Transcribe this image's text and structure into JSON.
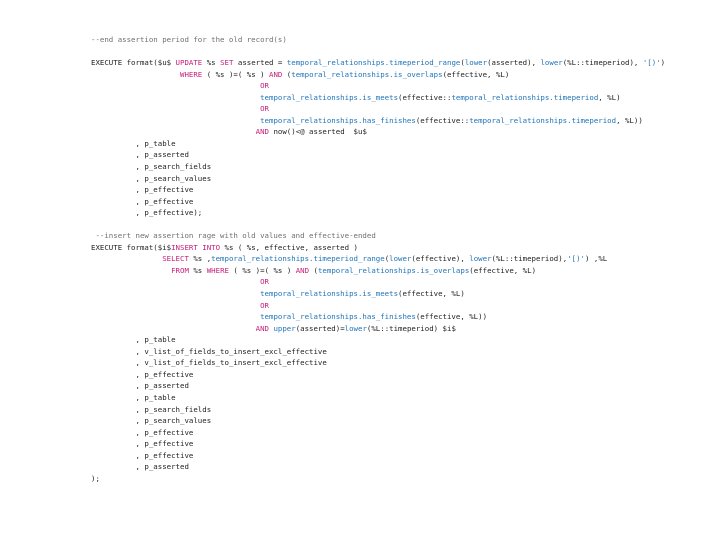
{
  "colors": {
    "plain": "#222222",
    "comment": "#6f6f6f",
    "keyword": "#c81e7a",
    "function": "#1e73b8",
    "string": "#1e73b8"
  },
  "code_lines": [
    {
      "indent": "",
      "tokens": [
        {
          "t": "--end assertion period for the old record(s)",
          "k": "comment"
        }
      ]
    },
    {
      "indent": "",
      "tokens": []
    },
    {
      "indent": "",
      "tokens": [
        {
          "t": "EXECUTE format($u$ ",
          "k": "plain"
        },
        {
          "t": "UPDATE",
          "k": "keyword"
        },
        {
          "t": " %s ",
          "k": "plain"
        },
        {
          "t": "SET",
          "k": "keyword"
        },
        {
          "t": " asserted = ",
          "k": "plain"
        },
        {
          "t": "temporal_relationships.timeperiod_range",
          "k": "function"
        },
        {
          "t": "(",
          "k": "plain"
        },
        {
          "t": "lower",
          "k": "function"
        },
        {
          "t": "(asserted), ",
          "k": "plain"
        },
        {
          "t": "lower",
          "k": "function"
        },
        {
          "t": "(%L::timeperiod), ",
          "k": "plain"
        },
        {
          "t": "'[)'",
          "k": "string"
        },
        {
          "t": ")",
          "k": "plain"
        }
      ]
    },
    {
      "indent": "                    ",
      "tokens": [
        {
          "t": "WHERE",
          "k": "keyword"
        },
        {
          "t": " ( %s )=( %s ) ",
          "k": "plain"
        },
        {
          "t": "AND",
          "k": "keyword"
        },
        {
          "t": " (",
          "k": "plain"
        },
        {
          "t": "temporal_relationships.is_overlaps",
          "k": "function"
        },
        {
          "t": "(effective, %L)",
          "k": "plain"
        }
      ]
    },
    {
      "indent": "                                      ",
      "tokens": [
        {
          "t": "OR",
          "k": "keyword"
        }
      ]
    },
    {
      "indent": "                                      ",
      "tokens": [
        {
          "t": "temporal_relationships.is_meets",
          "k": "function"
        },
        {
          "t": "(effective::",
          "k": "plain"
        },
        {
          "t": "temporal_relationships.timeperiod",
          "k": "function"
        },
        {
          "t": ", %L)",
          "k": "plain"
        }
      ]
    },
    {
      "indent": "                                      ",
      "tokens": [
        {
          "t": "OR",
          "k": "keyword"
        }
      ]
    },
    {
      "indent": "                                      ",
      "tokens": [
        {
          "t": "temporal_relationships.has_finishes",
          "k": "function"
        },
        {
          "t": "(effective::",
          "k": "plain"
        },
        {
          "t": "temporal_relationships.timeperiod",
          "k": "function"
        },
        {
          "t": ", %L))",
          "k": "plain"
        }
      ]
    },
    {
      "indent": "                                     ",
      "tokens": [
        {
          "t": "AND",
          "k": "keyword"
        },
        {
          "t": " now()<@ asserted  $u$",
          "k": "plain"
        }
      ]
    },
    {
      "indent": "          ",
      "tokens": [
        {
          "t": ", p_table",
          "k": "plain"
        }
      ]
    },
    {
      "indent": "          ",
      "tokens": [
        {
          "t": ", p_asserted",
          "k": "plain"
        }
      ]
    },
    {
      "indent": "          ",
      "tokens": [
        {
          "t": ", p_search_fields",
          "k": "plain"
        }
      ]
    },
    {
      "indent": "          ",
      "tokens": [
        {
          "t": ", p_search_values",
          "k": "plain"
        }
      ]
    },
    {
      "indent": "          ",
      "tokens": [
        {
          "t": ", p_effective",
          "k": "plain"
        }
      ]
    },
    {
      "indent": "          ",
      "tokens": [
        {
          "t": ", p_effective",
          "k": "plain"
        }
      ]
    },
    {
      "indent": "          ",
      "tokens": [
        {
          "t": ", p_effective);",
          "k": "plain"
        }
      ]
    },
    {
      "indent": "",
      "tokens": []
    },
    {
      "indent": " ",
      "tokens": [
        {
          "t": "--insert new assertion rage with old values and effective-ended",
          "k": "comment"
        }
      ]
    },
    {
      "indent": "",
      "tokens": [
        {
          "t": "EXECUTE format($i$",
          "k": "plain"
        },
        {
          "t": "INSERT INTO",
          "k": "keyword"
        },
        {
          "t": " %s ( %s, effective, asserted )",
          "k": "plain"
        }
      ]
    },
    {
      "indent": "                ",
      "tokens": [
        {
          "t": "SELECT",
          "k": "keyword"
        },
        {
          "t": " %s ,",
          "k": "plain"
        },
        {
          "t": "temporal_relationships.timeperiod_range",
          "k": "function"
        },
        {
          "t": "(",
          "k": "plain"
        },
        {
          "t": "lower",
          "k": "function"
        },
        {
          "t": "(effective), ",
          "k": "plain"
        },
        {
          "t": "lower",
          "k": "function"
        },
        {
          "t": "(%L::timeperiod),",
          "k": "plain"
        },
        {
          "t": "'[)'",
          "k": "string"
        },
        {
          "t": ") ,%L",
          "k": "plain"
        }
      ]
    },
    {
      "indent": "                  ",
      "tokens": [
        {
          "t": "FROM",
          "k": "keyword"
        },
        {
          "t": " %s ",
          "k": "plain"
        },
        {
          "t": "WHERE",
          "k": "keyword"
        },
        {
          "t": " ( %s )=( %s ) ",
          "k": "plain"
        },
        {
          "t": "AND",
          "k": "keyword"
        },
        {
          "t": " (",
          "k": "plain"
        },
        {
          "t": "temporal_relationships.is_overlaps",
          "k": "function"
        },
        {
          "t": "(effective, %L)",
          "k": "plain"
        }
      ]
    },
    {
      "indent": "                                      ",
      "tokens": [
        {
          "t": "OR",
          "k": "keyword"
        }
      ]
    },
    {
      "indent": "                                      ",
      "tokens": [
        {
          "t": "temporal_relationships.is_meets",
          "k": "function"
        },
        {
          "t": "(effective, %L)",
          "k": "plain"
        }
      ]
    },
    {
      "indent": "                                      ",
      "tokens": [
        {
          "t": "OR",
          "k": "keyword"
        }
      ]
    },
    {
      "indent": "                                      ",
      "tokens": [
        {
          "t": "temporal_relationships.has_finishes",
          "k": "function"
        },
        {
          "t": "(effective, %L))",
          "k": "plain"
        }
      ]
    },
    {
      "indent": "                                     ",
      "tokens": [
        {
          "t": "AND",
          "k": "keyword"
        },
        {
          "t": " ",
          "k": "plain"
        },
        {
          "t": "upper",
          "k": "function"
        },
        {
          "t": "(asserted)=",
          "k": "plain"
        },
        {
          "t": "lower",
          "k": "function"
        },
        {
          "t": "(%L::timeperiod) $i$",
          "k": "plain"
        }
      ]
    },
    {
      "indent": "          ",
      "tokens": [
        {
          "t": ", p_table",
          "k": "plain"
        }
      ]
    },
    {
      "indent": "          ",
      "tokens": [
        {
          "t": ", v_list_of_fields_to_insert_excl_effective",
          "k": "plain"
        }
      ]
    },
    {
      "indent": "          ",
      "tokens": [
        {
          "t": ", v_list_of_fields_to_insert_excl_effective",
          "k": "plain"
        }
      ]
    },
    {
      "indent": "          ",
      "tokens": [
        {
          "t": ", p_effective",
          "k": "plain"
        }
      ]
    },
    {
      "indent": "          ",
      "tokens": [
        {
          "t": ", p_asserted",
          "k": "plain"
        }
      ]
    },
    {
      "indent": "          ",
      "tokens": [
        {
          "t": ", p_table",
          "k": "plain"
        }
      ]
    },
    {
      "indent": "          ",
      "tokens": [
        {
          "t": ", p_search_fields",
          "k": "plain"
        }
      ]
    },
    {
      "indent": "          ",
      "tokens": [
        {
          "t": ", p_search_values",
          "k": "plain"
        }
      ]
    },
    {
      "indent": "          ",
      "tokens": [
        {
          "t": ", p_effective",
          "k": "plain"
        }
      ]
    },
    {
      "indent": "          ",
      "tokens": [
        {
          "t": ", p_effective",
          "k": "plain"
        }
      ]
    },
    {
      "indent": "          ",
      "tokens": [
        {
          "t": ", p_effective",
          "k": "plain"
        }
      ]
    },
    {
      "indent": "          ",
      "tokens": [
        {
          "t": ", p_asserted",
          "k": "plain"
        }
      ]
    },
    {
      "indent": "",
      "tokens": [
        {
          "t": ");",
          "k": "plain"
        }
      ]
    }
  ]
}
